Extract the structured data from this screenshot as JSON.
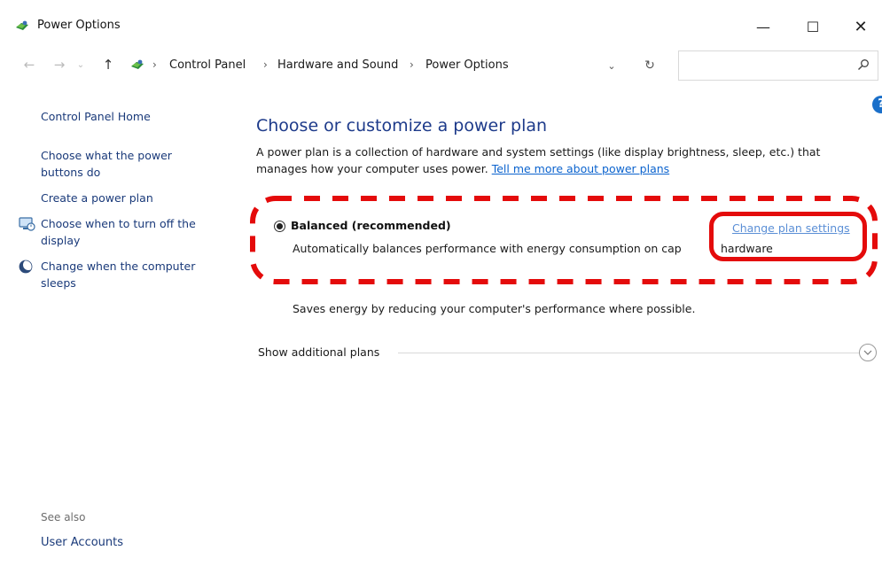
{
  "window": {
    "title": "Power Options",
    "controls": {
      "minimize": "—",
      "maximize": "☐",
      "close": "✕"
    }
  },
  "address": {
    "breadcrumbs": [
      "Control Panel",
      "Hardware and Sound",
      "Power Options"
    ],
    "separator": "›",
    "dropdown_glyph": "⌄",
    "refresh_glyph": "↻",
    "search_placeholder": ""
  },
  "nav_buttons": {
    "back": "←",
    "forward": "→",
    "recent": "⌄",
    "up": "↑"
  },
  "left_nav": {
    "home": "Control Panel Home",
    "items": [
      "Choose what the power buttons do",
      "Create a power plan",
      "Choose when to turn off the display",
      "Change when the computer sleeps"
    ],
    "see_also_heading": "See also",
    "see_also_items": [
      "User Accounts"
    ]
  },
  "main": {
    "title": "Choose or customize a power plan",
    "description": "A power plan is a collection of hardware and system settings (like display brightness, sleep, etc.) that manages how your computer uses power.",
    "learn_more_link": "Tell me more about power plans",
    "plan": {
      "name": "Balanced (recommended)",
      "description": "Automatically balances performance with energy consumption on cap",
      "description_tail": "hardware",
      "selected": true,
      "change_link": "Change plan settings"
    },
    "other_plan_description": "Saves energy by reducing your computer's performance where possible.",
    "show_additional_plans": "Show additional plans",
    "help_glyph": "?"
  },
  "icons": {
    "app": "power-options-icon",
    "address": "power-options-icon",
    "search": "search-icon",
    "display": "display-icon",
    "sleep": "moon-icon",
    "expand": "chevron-down-icon"
  },
  "colors": {
    "link": "#1a3a7a",
    "heading": "#1d3a8a",
    "annotation": "#e40b0b",
    "hyperlink": "#0b63ce"
  }
}
